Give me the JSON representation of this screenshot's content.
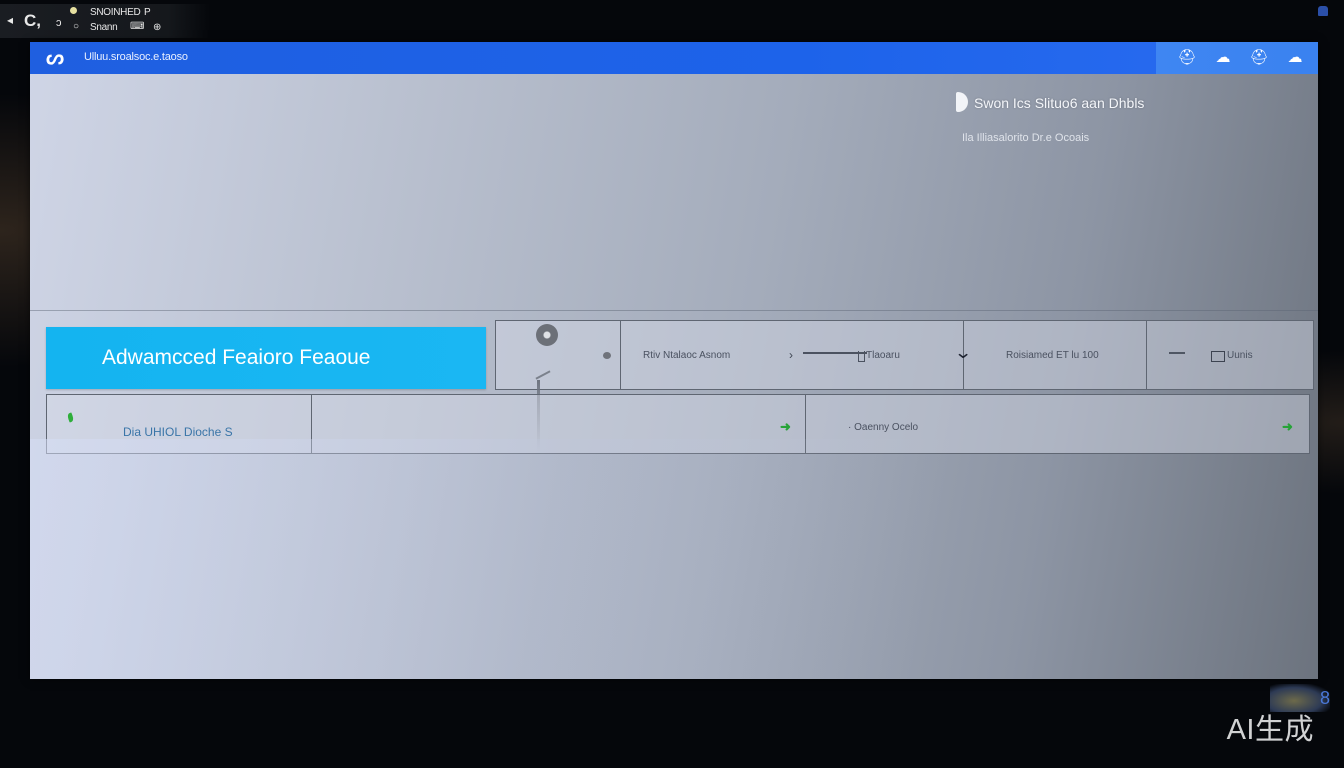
{
  "os_bar": {
    "back_glyph": "◂",
    "reload_glyph": "C,",
    "glyph_a": "ↄ",
    "glyph_b": "○",
    "line1_text": "SNOINHED",
    "line1_icon": "P",
    "line2_text": "Snann",
    "keyboard_glyph": "⌨",
    "line2_icon": "⊕"
  },
  "window": {
    "logo_glyph": "ᔕ",
    "title": "Ulluu.sroalsoc.e.taoso",
    "toolbar": [
      {
        "icon": "user-icon",
        "glyph": "⛑"
      },
      {
        "icon": "chat-icon",
        "glyph": "☁"
      },
      {
        "icon": "profile-icon",
        "glyph": "⛑"
      },
      {
        "icon": "message-icon",
        "glyph": "☁"
      }
    ]
  },
  "info": {
    "title": "Swon Ics Slituo6 aan Dhbls",
    "subtitle": "Ila Illiasalorito Dr.e Ocoais"
  },
  "feature": {
    "label": "Adwamcced Feaioro Feaoue"
  },
  "row1": {
    "cell2_left": "Rtiv Ntalaoc Asnom",
    "cell2_arrow": "›",
    "cell2_right": "Tlaoaru",
    "cell3_chevron": "⌄",
    "cell3_text": "Roisiamed ET lu 100",
    "cell4_text": "Uunis"
  },
  "row2": {
    "left_text": "Dia UHIOL Dioche S",
    "right_text": "· Oaenny Ocelo",
    "go_glyph": "➜"
  },
  "overlay": {
    "watermark": "AI生成",
    "badge": "8"
  },
  "colors": {
    "titlebar": "#1f5fe0",
    "feature": "#14b4f0",
    "go_arrow": "#27a338"
  }
}
